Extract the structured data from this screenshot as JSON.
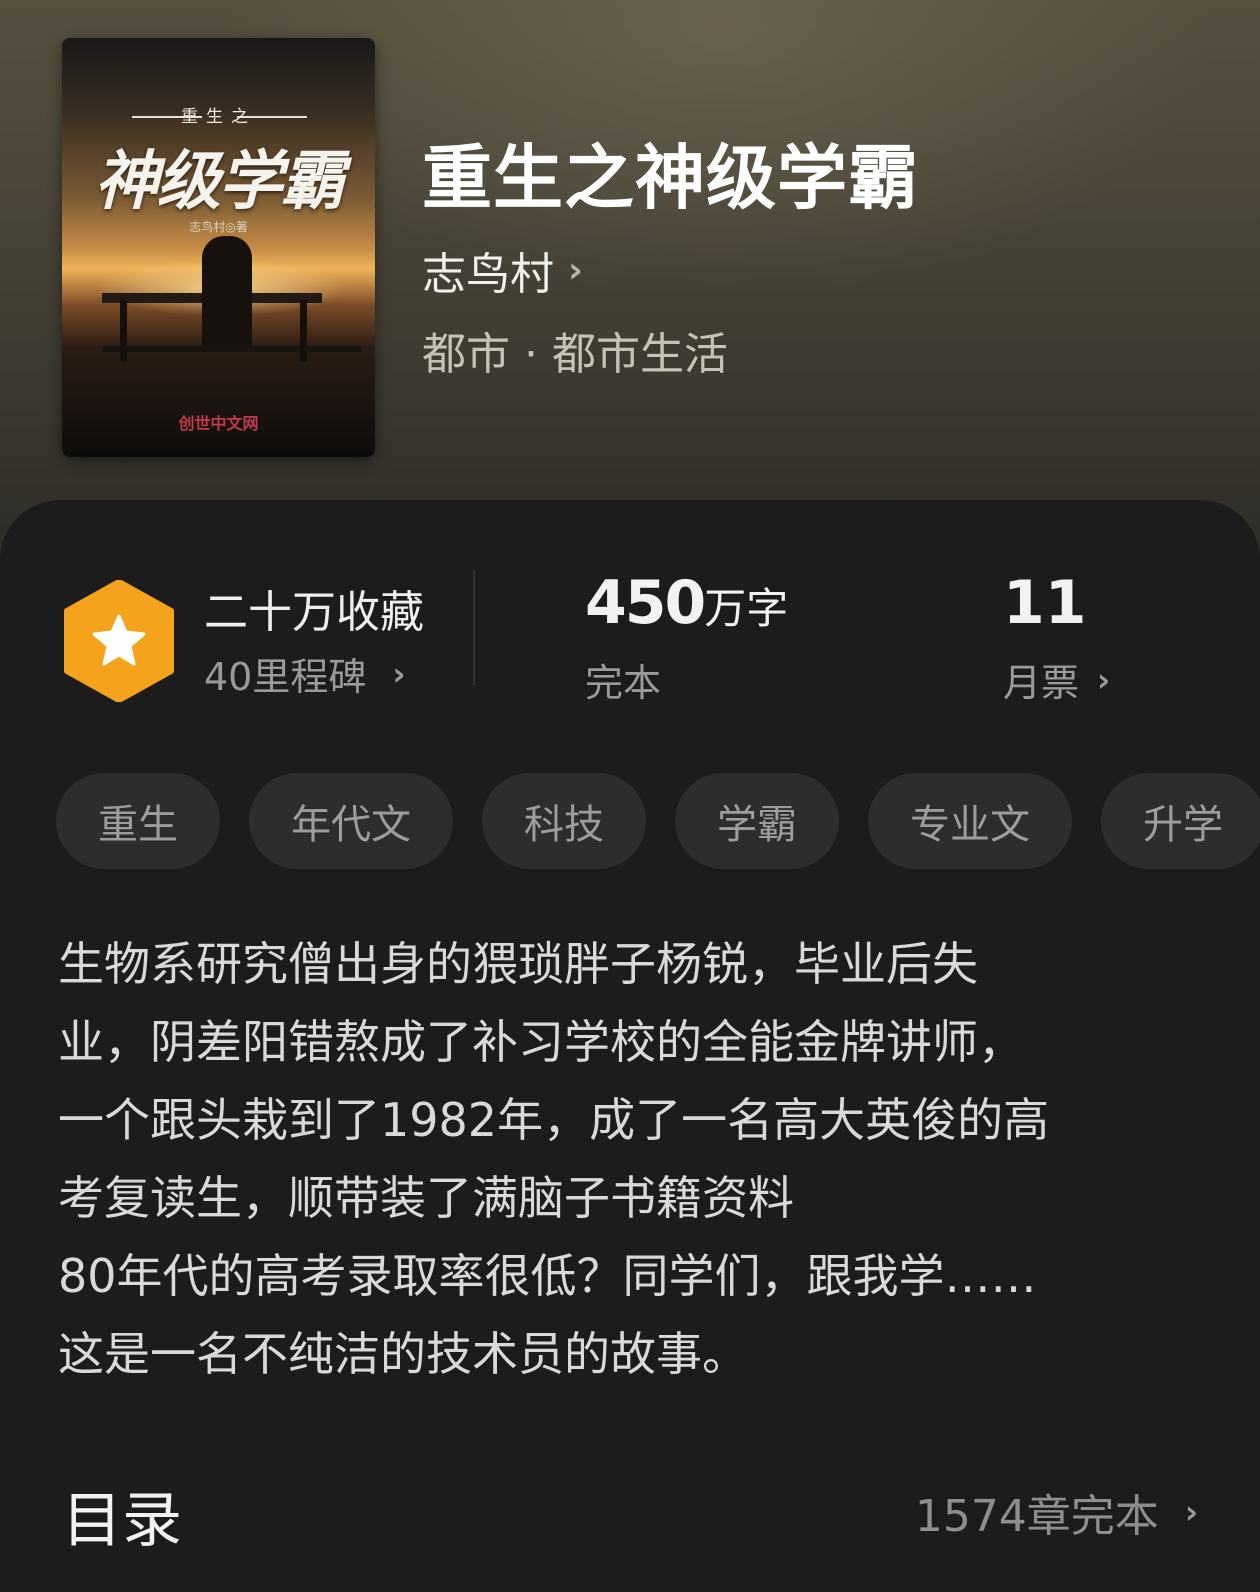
{
  "cover": {
    "subtitle": "重生之",
    "title": "神级学霸",
    "author_line": "志鸟村◎著",
    "publisher": "创世中文网"
  },
  "book": {
    "title": "重生之神级学霸",
    "author": "志鸟村",
    "genre": "都市",
    "subgenre": "都市生活",
    "genre_sep": "·"
  },
  "stats": {
    "favorites": "二十万收藏",
    "milestone": "40里程碑",
    "words_value": "450",
    "words_unit": "万字",
    "status": "完本",
    "monthly_votes_value": "11",
    "monthly_votes_label": "月票"
  },
  "tags": [
    "重生",
    "年代文",
    "科技",
    "学霸",
    "专业文",
    "升学"
  ],
  "synopsis": {
    "lines": [
      "生物系研究僧出身的猥琐胖子杨锐，毕业后失",
      "业，阴差阳错熬成了补习学校的全能金牌讲师，",
      "一个跟头栽到了1982年，成了一名高大英俊的高",
      "考复读生，顺带装了满脑子书籍资料",
      "80年代的高考录取率很低？同学们，跟我学……",
      "这是一名不纯洁的技术员的故事。"
    ]
  },
  "toc": {
    "title": "目录",
    "info": "1574章完本"
  },
  "colors": {
    "badge": "#f5a31d",
    "background": "#1c1c1c"
  },
  "icons": {
    "chevron": "›"
  }
}
